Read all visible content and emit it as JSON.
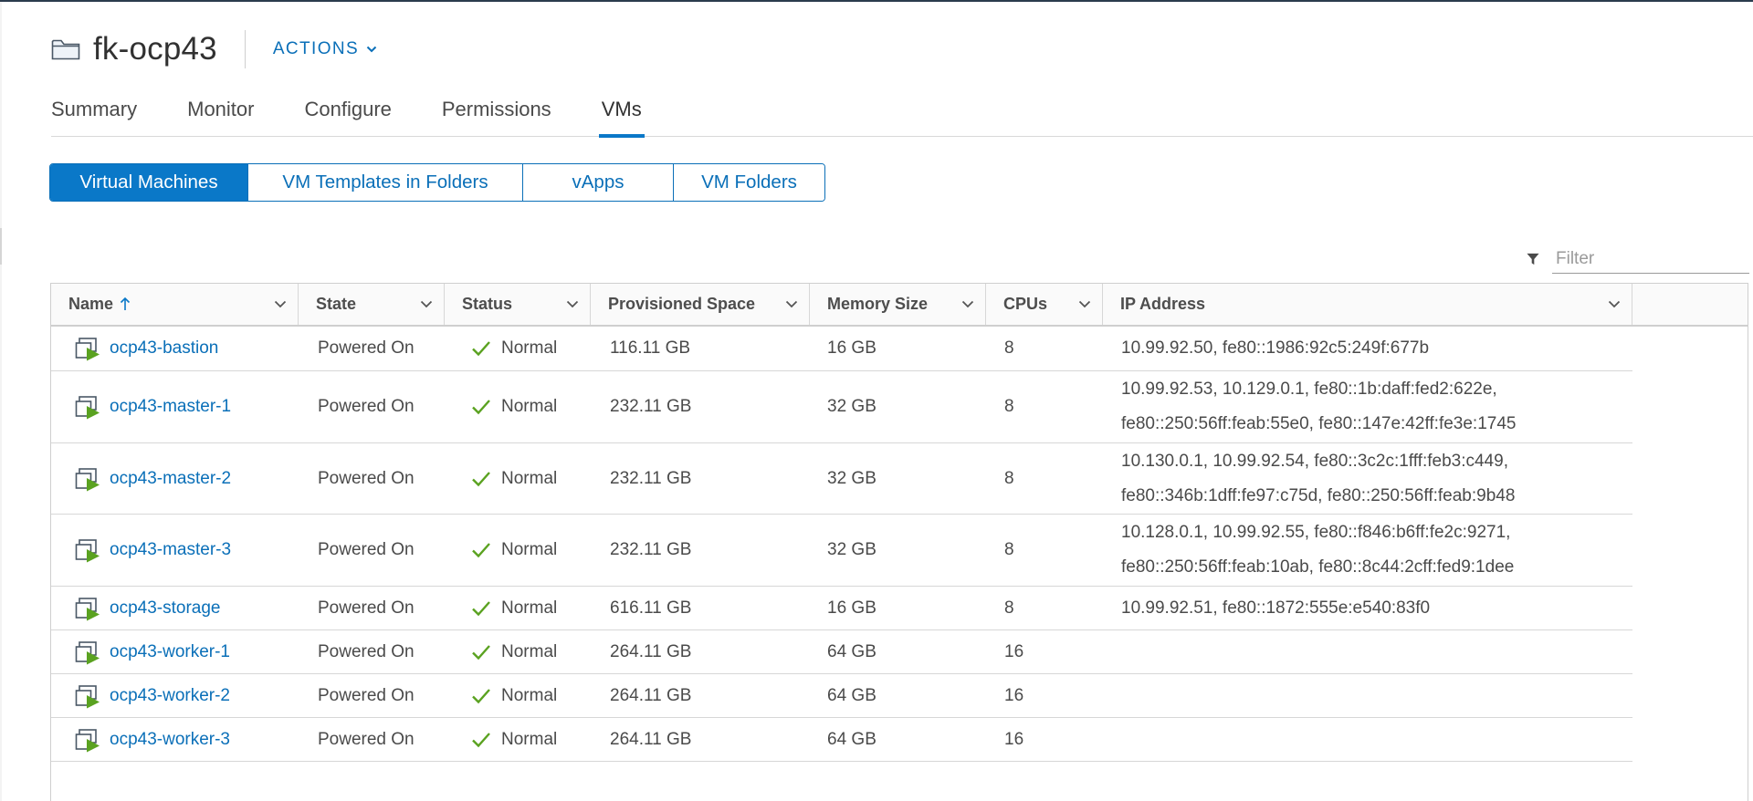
{
  "header": {
    "title": "fk-ocp43",
    "actions_label": "ACTIONS"
  },
  "tabs": [
    {
      "label": "Summary",
      "active": false
    },
    {
      "label": "Monitor",
      "active": false
    },
    {
      "label": "Configure",
      "active": false
    },
    {
      "label": "Permissions",
      "active": false
    },
    {
      "label": "VMs",
      "active": true
    }
  ],
  "segments": [
    {
      "label": "Virtual Machines",
      "active": true
    },
    {
      "label": "VM Templates in Folders",
      "active": false
    },
    {
      "label": "vApps",
      "active": false
    },
    {
      "label": "VM Folders",
      "active": false
    }
  ],
  "filter": {
    "placeholder": "Filter"
  },
  "table": {
    "columns": [
      "Name",
      "State",
      "Status",
      "Provisioned Space",
      "Memory Size",
      "CPUs",
      "IP Address"
    ],
    "sort_column": "Name",
    "sort_direction": "ascending",
    "rows": [
      {
        "name": "ocp43-bastion",
        "state": "Powered On",
        "status": "Normal",
        "space": "116.11 GB",
        "memory": "16 GB",
        "cpus": "8",
        "ip1": "10.99.92.50, fe80::1986:92c5:249f:677b",
        "ip2": ""
      },
      {
        "name": "ocp43-master-1",
        "state": "Powered On",
        "status": "Normal",
        "space": "232.11 GB",
        "memory": "32 GB",
        "cpus": "8",
        "ip1": "10.99.92.53, 10.129.0.1, fe80::1b:daff:fed2:622e,",
        "ip2": "fe80::250:56ff:feab:55e0, fe80::147e:42ff:fe3e:1745"
      },
      {
        "name": "ocp43-master-2",
        "state": "Powered On",
        "status": "Normal",
        "space": "232.11 GB",
        "memory": "32 GB",
        "cpus": "8",
        "ip1": "10.130.0.1, 10.99.92.54, fe80::3c2c:1fff:feb3:c449,",
        "ip2": "fe80::346b:1dff:fe97:c75d, fe80::250:56ff:feab:9b48"
      },
      {
        "name": "ocp43-master-3",
        "state": "Powered On",
        "status": "Normal",
        "space": "232.11 GB",
        "memory": "32 GB",
        "cpus": "8",
        "ip1": "10.128.0.1, 10.99.92.55, fe80::f846:b6ff:fe2c:9271,",
        "ip2": "fe80::250:56ff:feab:10ab, fe80::8c44:2cff:fed9:1dee"
      },
      {
        "name": "ocp43-storage",
        "state": "Powered On",
        "status": "Normal",
        "space": "616.11 GB",
        "memory": "16 GB",
        "cpus": "8",
        "ip1": "10.99.92.51, fe80::1872:555e:e540:83f0",
        "ip2": ""
      },
      {
        "name": "ocp43-worker-1",
        "state": "Powered On",
        "status": "Normal",
        "space": "264.11 GB",
        "memory": "64 GB",
        "cpus": "16",
        "ip1": "",
        "ip2": ""
      },
      {
        "name": "ocp43-worker-2",
        "state": "Powered On",
        "status": "Normal",
        "space": "264.11 GB",
        "memory": "64 GB",
        "cpus": "16",
        "ip1": "",
        "ip2": ""
      },
      {
        "name": "ocp43-worker-3",
        "state": "Powered On",
        "status": "Normal",
        "space": "264.11 GB",
        "memory": "64 GB",
        "cpus": "16",
        "ip1": "",
        "ip2": ""
      }
    ]
  },
  "colors": {
    "accent": "#0a78c8",
    "link": "#0a6fb8",
    "status_ok": "#5aa220"
  },
  "icons": {
    "folder": "folder-icon",
    "vm": "vm-powered-on-icon",
    "status": "check-icon",
    "filter": "filter-icon"
  }
}
